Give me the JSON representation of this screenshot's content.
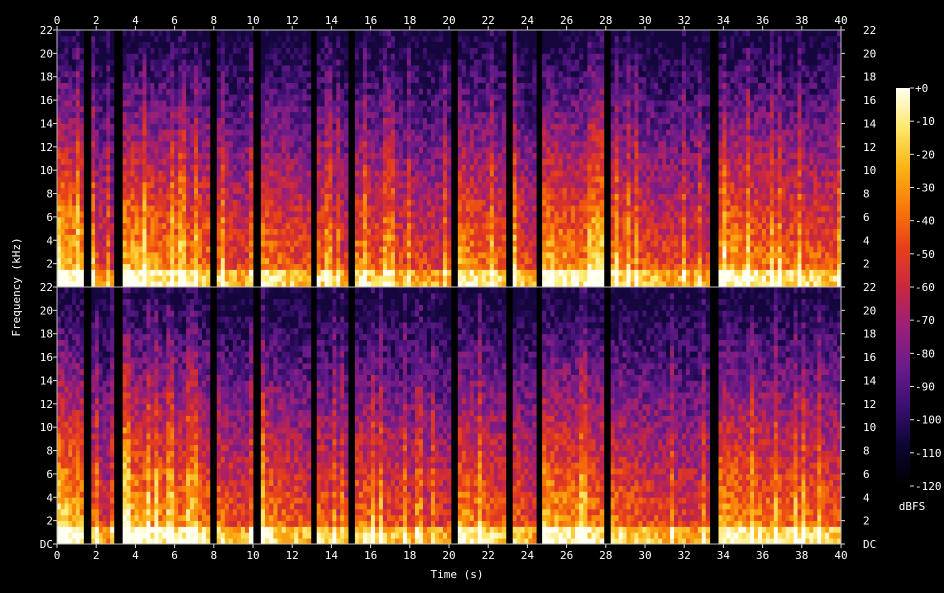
{
  "chart_data": {
    "type": "heatmap",
    "subtype": "spectrogram",
    "channels": 2,
    "xlabel": "Time (s)",
    "ylabel": "Frequency (kHz)",
    "xlim": [
      0,
      40
    ],
    "x_ticks": [
      0,
      2,
      4,
      6,
      8,
      10,
      12,
      14,
      16,
      18,
      20,
      22,
      24,
      26,
      28,
      30,
      32,
      34,
      36,
      38,
      40
    ],
    "ylim_khz": [
      0,
      22
    ],
    "y_ticks": [
      "DC",
      "2",
      "4",
      "6",
      "8",
      "10",
      "12",
      "14",
      "16",
      "18",
      "20",
      "22"
    ],
    "colorbar": {
      "label": "dBFS",
      "range": [
        -120,
        0
      ],
      "ticks": [
        "+0",
        "-10",
        "-20",
        "-30",
        "-40",
        "-50",
        "-60",
        "-70",
        "-80",
        "-90",
        "-100",
        "-110",
        "-120"
      ],
      "colormap": [
        "#000000",
        "#0b0530",
        "#3b0f70",
        "#6a1b8a",
        "#9a1f78",
        "#c8283f",
        "#e8401a",
        "#f87a0a",
        "#fbb315",
        "#fde86a",
        "#fffff2"
      ]
    },
    "silent_gaps_s": [
      [
        1.35,
        1.75
      ],
      [
        2.9,
        3.35
      ],
      [
        7.8,
        8.15
      ],
      [
        10.0,
        10.4
      ],
      [
        12.95,
        13.25
      ],
      [
        14.85,
        15.2
      ],
      [
        20.1,
        20.45
      ],
      [
        22.9,
        23.25
      ],
      [
        24.45,
        24.75
      ],
      [
        27.9,
        28.25
      ],
      [
        33.3,
        33.75
      ]
    ],
    "segments": [
      {
        "start": 0.0,
        "end": 1.35,
        "loudness": 0.85
      },
      {
        "start": 1.75,
        "end": 2.9,
        "loudness": 0.55
      },
      {
        "start": 3.35,
        "end": 7.8,
        "loudness": 0.75
      },
      {
        "start": 8.15,
        "end": 10.0,
        "loudness": 0.6
      },
      {
        "start": 10.4,
        "end": 12.95,
        "loudness": 0.65
      },
      {
        "start": 13.25,
        "end": 14.85,
        "loudness": 0.6
      },
      {
        "start": 15.2,
        "end": 20.1,
        "loudness": 0.6
      },
      {
        "start": 20.45,
        "end": 22.9,
        "loudness": 0.7
      },
      {
        "start": 23.25,
        "end": 24.45,
        "loudness": 0.6
      },
      {
        "start": 24.75,
        "end": 27.9,
        "loudness": 0.75
      },
      {
        "start": 28.25,
        "end": 33.3,
        "loudness": 0.6
      },
      {
        "start": 33.75,
        "end": 40.0,
        "loudness": 0.7
      }
    ]
  }
}
